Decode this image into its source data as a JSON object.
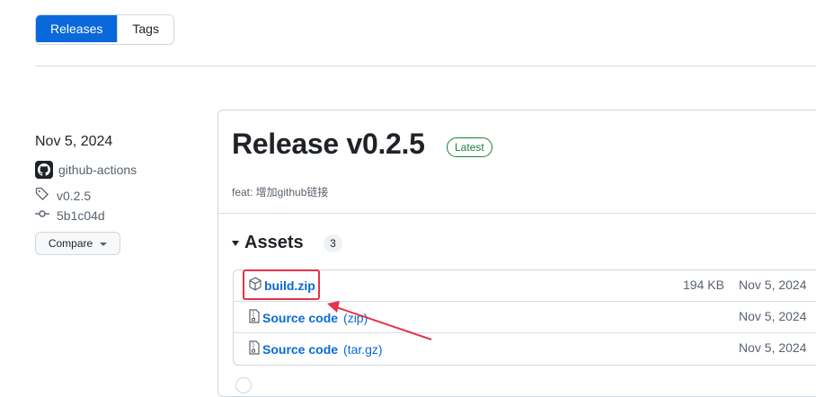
{
  "tabs": {
    "releases": "Releases",
    "tags": "Tags"
  },
  "release_meta": {
    "date": "Nov 5, 2024",
    "author": "github-actions",
    "tag": "v0.2.5",
    "commit": "5b1c04d",
    "compare_label": "Compare"
  },
  "release": {
    "title": "Release v0.2.5",
    "badge": "Latest",
    "notes": "feat: 增加github链接"
  },
  "assets": {
    "label": "Assets",
    "count": "3",
    "items": [
      {
        "name": "build.zip",
        "suffix": "",
        "size": "194 KB",
        "date": "Nov 5, 2024"
      },
      {
        "name": "Source code",
        "suffix": "(zip)",
        "size": "",
        "date": "Nov 5, 2024"
      },
      {
        "name": "Source code",
        "suffix": "(tar.gz)",
        "size": "",
        "date": "Nov 5, 2024"
      }
    ]
  },
  "colors": {
    "accent": "#0969da",
    "latest": "#1a7f37",
    "annotation": "#e5334b"
  }
}
